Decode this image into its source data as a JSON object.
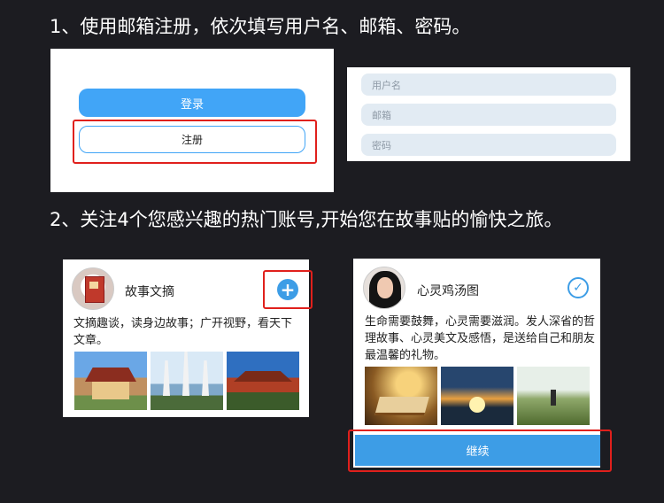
{
  "steps": {
    "step1": "1、使用邮箱注册，依次填写用户名、邮箱、密码。",
    "step2": "2、关注4个您感兴趣的热门账号,开始您在故事贴的愉快之旅。"
  },
  "login_panel": {
    "login_label": "登录",
    "register_label": "注册"
  },
  "form": {
    "username_placeholder": "用户名",
    "email_placeholder": "邮箱",
    "password_placeholder": "密码"
  },
  "cards": [
    {
      "name": "故事文摘",
      "description": "文摘趣谈，读身边故事；广开视野，看天下文章。",
      "follow_icon": "plus-icon",
      "followed": false
    },
    {
      "name": "心灵鸡汤图",
      "description": "生命需要鼓舞，心灵需要滋润。发人深省的哲理故事、心灵美文及感悟，是送给自己和朋友最温馨的礼物。",
      "follow_icon": "check-icon",
      "followed": true
    }
  ],
  "continue_label": "继续",
  "colors": {
    "accent": "#3d9de6",
    "highlight": "#e0201c",
    "background": "#1c1c21"
  }
}
